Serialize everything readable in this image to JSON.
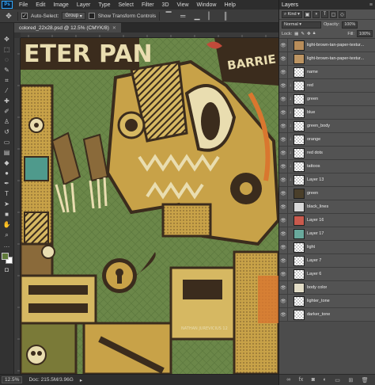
{
  "app": {
    "logo": "Ps"
  },
  "menu": [
    "File",
    "Edit",
    "Image",
    "Layer",
    "Type",
    "Select",
    "Filter",
    "3D",
    "View",
    "Window",
    "Help"
  ],
  "options": {
    "auto_select_label": "Auto-Select:",
    "auto_select_value": "Group",
    "transform_controls_label": "Show Transform Controls"
  },
  "document": {
    "tab_title": "colored_22x28.psd @ 12.5% (CMYK/8)",
    "zoom": "12.5%",
    "doc_size": "Doc: 215.5M/3.96G",
    "artwork_text_left": "ETER PAN",
    "artwork_text_right": "BARRIE",
    "artwork_signature": "NATHAN JUREVICIUS 12"
  },
  "layers_panel": {
    "tab": "Layers",
    "filter_kind": "Kind",
    "blend_mode": "Normal",
    "opacity_label": "Opacity:",
    "opacity_value": "100%",
    "lock_label": "Lock:",
    "fill_label": "Fill:",
    "fill_value": "100%",
    "layers": [
      {
        "name": "light-brown-tan-paper-textur...",
        "thumb": "#b88d5a",
        "eye": true,
        "clip": false
      },
      {
        "name": "light-brown-tan-paper-textur...",
        "thumb": "#bd9563",
        "eye": true,
        "clip": false
      },
      {
        "name": "name",
        "thumb": "transparent",
        "eye": true,
        "clip": false
      },
      {
        "name": "red",
        "thumb": "transparent",
        "eye": true,
        "clip": true
      },
      {
        "name": "green",
        "thumb": "transparent",
        "eye": true,
        "clip": true
      },
      {
        "name": "blue",
        "thumb": "transparent",
        "eye": true,
        "clip": true
      },
      {
        "name": "green_body",
        "thumb": "transparent",
        "eye": true,
        "clip": true
      },
      {
        "name": "orange",
        "thumb": "transparent",
        "eye": true,
        "clip": true
      },
      {
        "name": "red dots",
        "thumb": "transparent",
        "eye": true,
        "clip": true
      },
      {
        "name": "tattoos",
        "thumb": "transparent",
        "eye": true,
        "clip": true
      },
      {
        "name": "Layer 13",
        "thumb": "transparent",
        "eye": true,
        "clip": true
      },
      {
        "name": "green",
        "thumb": "#4a3f2a",
        "eye": true,
        "clip": false
      },
      {
        "name": "black_lines",
        "thumb": "#d8d8d8",
        "eye": true,
        "clip": false
      },
      {
        "name": "Layer 16",
        "thumb": "#c95a4d",
        "eye": true,
        "clip": false
      },
      {
        "name": "Layer 17",
        "thumb": "#69a99c",
        "eye": true,
        "clip": false
      },
      {
        "name": "light",
        "thumb": "transparent",
        "eye": true,
        "clip": false
      },
      {
        "name": "Layer 7",
        "thumb": "transparent",
        "eye": true,
        "clip": false
      },
      {
        "name": "Layer 6",
        "thumb": "transparent",
        "eye": true,
        "clip": false
      },
      {
        "name": "body color",
        "thumb": "#e2dcc6",
        "eye": true,
        "clip": false
      },
      {
        "name": "lighter_tone",
        "thumb": "transparent",
        "eye": true,
        "clip": false
      },
      {
        "name": "darker_tone",
        "thumb": "transparent",
        "eye": true,
        "clip": false
      }
    ]
  },
  "colors": {
    "foreground": "#5f7a3a",
    "background": "#ffffff",
    "art_bg": "#6e8a4c",
    "art_ochre": "#c8a248",
    "art_dark": "#3b2c1d",
    "art_orange": "#d9772f",
    "art_cream": "#e9ddb0",
    "art_teal": "#4f9a8c"
  }
}
